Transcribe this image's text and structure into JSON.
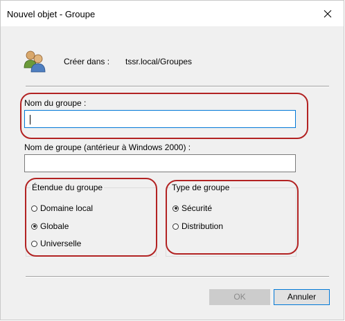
{
  "window": {
    "title": "Nouvel objet - Groupe",
    "close_icon": "close-icon"
  },
  "header": {
    "icon": "users-icon",
    "create_in_label": "Créer dans :",
    "create_in_value": "tssr.local/Groupes"
  },
  "form": {
    "group_name_label": "Nom du groupe :",
    "group_name_value": "",
    "legacy_name_label": "Nom de groupe (antérieur à Windows 2000) :",
    "legacy_name_value": ""
  },
  "scope": {
    "title": "Étendue du groupe",
    "options": [
      {
        "label": "Domaine local",
        "selected": false
      },
      {
        "label": "Globale",
        "selected": true
      },
      {
        "label": "Universelle",
        "selected": false
      }
    ]
  },
  "type": {
    "title": "Type de groupe",
    "options": [
      {
        "label": "Sécurité",
        "selected": true
      },
      {
        "label": "Distribution",
        "selected": false
      }
    ]
  },
  "buttons": {
    "ok": "OK",
    "cancel": "Annuler"
  },
  "colors": {
    "annotation": "#b22222",
    "focus": "#0078d7",
    "dialog_bg": "#f0f0f0"
  }
}
